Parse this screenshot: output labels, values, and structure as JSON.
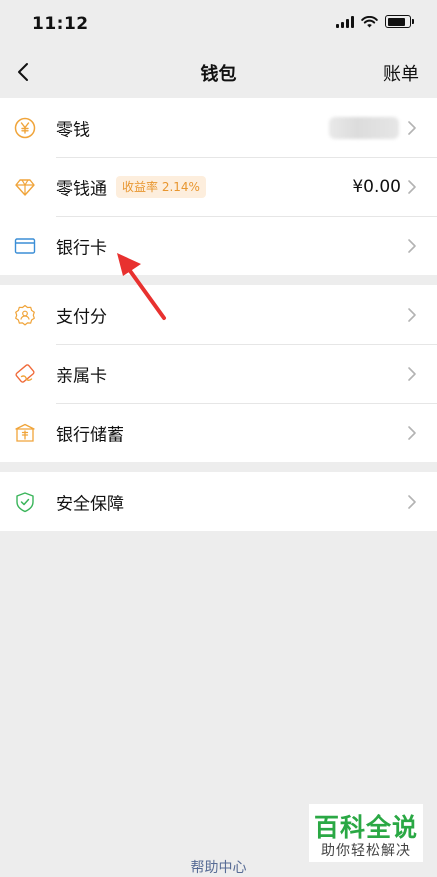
{
  "status_bar": {
    "time": "11:12"
  },
  "nav": {
    "title": "钱包",
    "right_action": "账单"
  },
  "group1": [
    {
      "label": "零钱",
      "icon": "yuan-coin-icon",
      "value": ""
    },
    {
      "label": "零钱通",
      "icon": "diamond-icon",
      "badge": "收益率 2.14%",
      "value": "¥0.00"
    },
    {
      "label": "银行卡",
      "icon": "bank-card-icon"
    }
  ],
  "group2": [
    {
      "label": "支付分",
      "icon": "payment-score-icon"
    },
    {
      "label": "亲属卡",
      "icon": "family-card-icon"
    },
    {
      "label": "银行储蓄",
      "icon": "bank-savings-icon"
    }
  ],
  "group3": [
    {
      "label": "安全保障",
      "icon": "shield-check-icon"
    }
  ],
  "footer": {
    "help_link": "帮助中心"
  },
  "watermark": {
    "title": "百科全说",
    "subtitle": "助你轻松解决"
  },
  "colors": {
    "accent_orange": "#f0a43a",
    "shield_green": "#3ab55a",
    "arrow_red": "#e8312f",
    "link_blue": "#576b95",
    "watermark_green": "#2aa844"
  }
}
